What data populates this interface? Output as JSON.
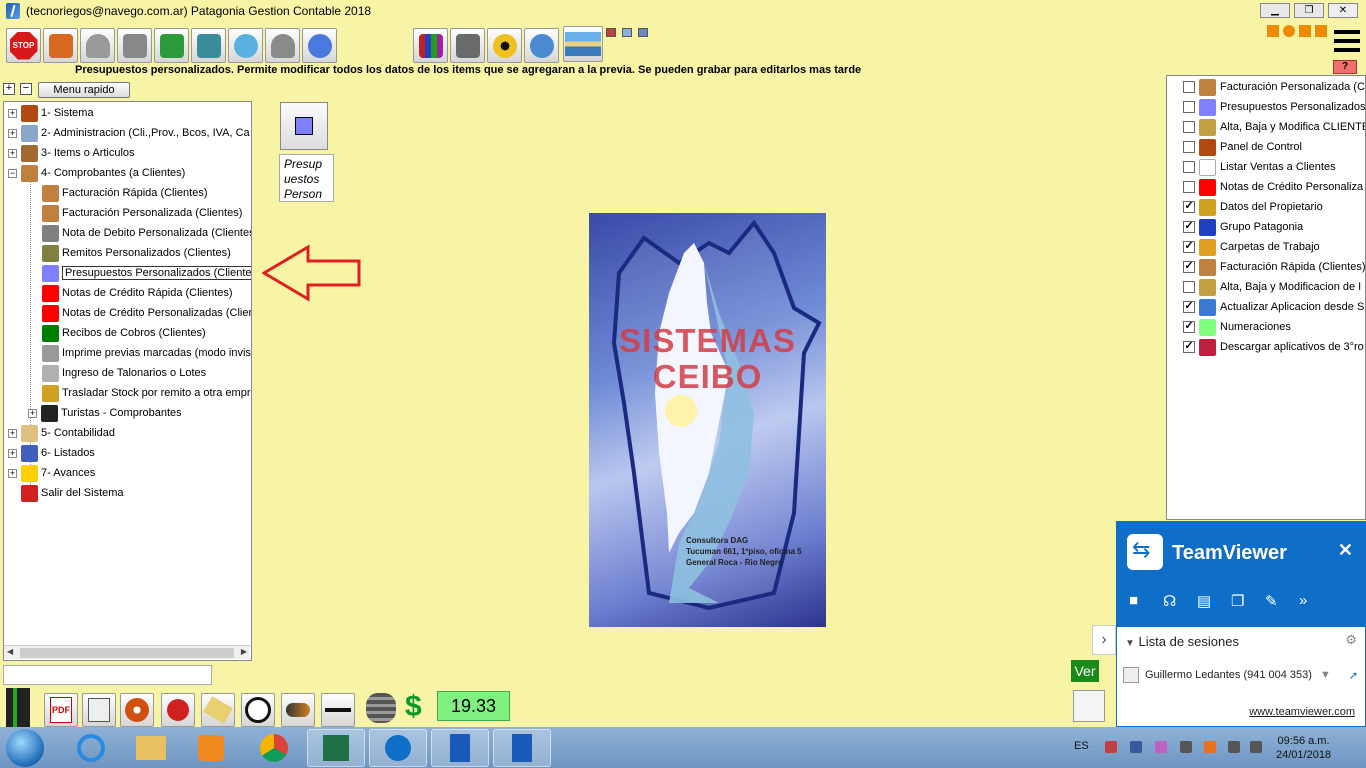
{
  "window": {
    "title": "(tecnoriegos@navego.com.ar) Patagonia Gestion Contable 2018",
    "min_label": "▁",
    "restore_label": "❐",
    "close_label": "✕"
  },
  "toolbar": {
    "stop_label": "STOP",
    "description": "Presupuestos personalizados. Permite modificar todos los datos de los items que se agregaran a la previa. Se pueden grabar para editarlos mas tarde"
  },
  "tree_controls": {
    "expand_label": "+",
    "collapse_label": "−",
    "menu_rapido_label": "Menu rapido"
  },
  "tree": {
    "items": [
      {
        "exp": "+",
        "label": "1- Sistema",
        "icon": "gear-icon",
        "color": "#b04a10"
      },
      {
        "exp": "+",
        "label": "2- Administracion (Cli.,Prov., Bcos, IVA, Ca",
        "icon": "admin-icon",
        "color": "#8aa6c8"
      },
      {
        "exp": "+",
        "label": "3- Items o Articulos",
        "icon": "items-icon",
        "color": "#a06a30"
      },
      {
        "exp": "−",
        "label": "4- Comprobantes (a Clientes)",
        "icon": "folder-icon",
        "color": "#c08040"
      },
      {
        "label": "Facturación Rápida (Clientes)",
        "icon": "invoice-icon",
        "color": "#c08040"
      },
      {
        "label": "Facturación Personalizada (Clientes)",
        "icon": "invoice-icon",
        "color": "#c08040"
      },
      {
        "label": "Nota de Debito Personalizada (Clientes",
        "icon": "gray-square-icon",
        "color": "#808080"
      },
      {
        "label": "Remitos Personalizados (Clientes)",
        "icon": "olive-square-icon",
        "color": "#808040"
      },
      {
        "label": "Presupuestos Personalizados (Clientes)",
        "icon": "blue-square-icon",
        "color": "#8080ff"
      },
      {
        "label": "Notas de Crédito Rápida (Clientes)",
        "icon": "red-square-icon",
        "color": "#ff0000"
      },
      {
        "label": "Notas de Crédito Personalizadas (Clien",
        "icon": "red-square-icon",
        "color": "#ff0000"
      },
      {
        "label": "Recibos de Cobros (Clientes)",
        "icon": "green-square-icon",
        "color": "#008000"
      },
      {
        "label": "Imprime previas marcadas (modo invisi",
        "icon": "printer-icon",
        "color": "#999999"
      },
      {
        "label": "Ingreso de Talonarios o Lotes",
        "icon": "ledger-icon",
        "color": "#b0b0b0"
      },
      {
        "label": "Trasladar Stock por remito a otra empre",
        "icon": "truck-icon",
        "color": "#d0a020"
      },
      {
        "exp": "+",
        "label": "Turistas - Comprobantes",
        "icon": "camera-icon",
        "color": "#222222"
      },
      {
        "exp": "+",
        "label": "5- Contabilidad",
        "icon": "notebook-icon",
        "color": "#e0c080"
      },
      {
        "exp": "+",
        "label": "6- Listados",
        "icon": "chart-icon",
        "color": "#4060c0"
      },
      {
        "exp": "+",
        "label": "7- Avances",
        "icon": "smiley-icon",
        "color": "#ffd000"
      },
      {
        "label": "Salir del Sistema",
        "icon": "exit-icon",
        "color": "#d02020"
      }
    ]
  },
  "preview": {
    "caption_line1": "Presup",
    "caption_line2": "uestos",
    "caption_line3": "Person"
  },
  "splash": {
    "title_line1": "SISTEMAS",
    "title_line2": "CEIBO",
    "small1": "Consultora DAG",
    "small2": "Tucuman 661, 1ºpiso, oficina 5",
    "small3": "General Roca - Rio Negro"
  },
  "right_panel": {
    "help_label": "?",
    "items": [
      {
        "checked": false,
        "label": "Facturación Personalizada (C",
        "icon": "invoice-icon",
        "color": "#c08040"
      },
      {
        "checked": false,
        "label": "Presupuestos Personalizados",
        "icon": "blue-square-icon",
        "color": "#8080ff"
      },
      {
        "checked": false,
        "label": "Alta, Baja y Modifica CLIENTE",
        "icon": "person-icon",
        "color": "#c0a040"
      },
      {
        "checked": false,
        "label": "Panel de Control",
        "icon": "gear-icon",
        "color": "#b04a10"
      },
      {
        "checked": false,
        "label": "Listar Ventas a Clientes",
        "icon": "list-icon",
        "color": "#ffffff"
      },
      {
        "checked": false,
        "label": "Notas de Crédito Personaliza",
        "icon": "red-square-icon",
        "color": "#ff0000"
      },
      {
        "checked": true,
        "label": "Datos del Propietario",
        "icon": "owner-icon",
        "color": "#d0a020"
      },
      {
        "checked": true,
        "label": "Grupo Patagonia",
        "icon": "group-icon",
        "color": "#2040c0"
      },
      {
        "checked": true,
        "label": "Carpetas de Trabajo",
        "icon": "folders-icon",
        "color": "#e0a020"
      },
      {
        "checked": true,
        "label": "Facturación Rápida (Clientes)",
        "icon": "invoice-icon",
        "color": "#c08040"
      },
      {
        "checked": false,
        "label": "Alta, Baja y Modificacion  de I",
        "icon": "person-icon",
        "color": "#c0a040"
      },
      {
        "checked": true,
        "label": "Actualizar Aplicacion desde S",
        "icon": "globe-icon",
        "color": "#3a7ad0"
      },
      {
        "checked": true,
        "label": "Numeraciones",
        "icon": "lightgreen-square-icon",
        "color": "#80ff80"
      },
      {
        "checked": true,
        "label": "Descargar aplicativos de 3°ro",
        "icon": "download-icon",
        "color": "#c02040"
      }
    ]
  },
  "bottom": {
    "value": "19.33",
    "ver_label": "Ver",
    "dollar_label": "$"
  },
  "teamviewer": {
    "title": "TeamViewer",
    "close_label": "✕",
    "sessions_label": "Lista de sesiones",
    "person": "Guillermo Ledantes (941 004 353)",
    "link": "www.teamviewer.com",
    "side_label": "›"
  },
  "taskbar": {
    "lang": "ES",
    "time": "09:56 a.m.",
    "date": "24/01/2018"
  }
}
